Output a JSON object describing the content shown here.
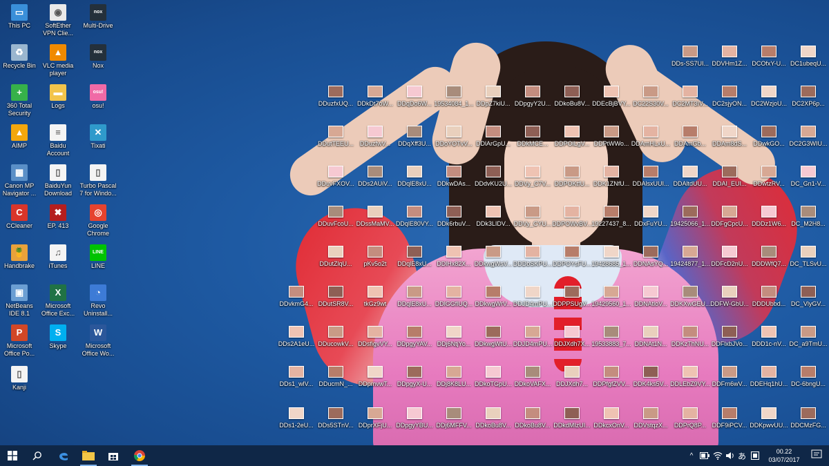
{
  "desktop": {
    "left_icons": [
      {
        "label": "This PC",
        "color": "#3a8fd9",
        "glyph": "▭",
        "icon": "computer-icon"
      },
      {
        "label": "SoftEther VPN Clie...",
        "color": "#e9e9e9",
        "glyph": "◉",
        "icon": "softether-icon"
      },
      {
        "label": "Multi-Drive",
        "color": "#24303b",
        "glyph": "nox",
        "icon": "nox-icon"
      },
      {
        "label": "Recycle Bin",
        "color": "#9ab6cf",
        "glyph": "♻",
        "icon": "recycle-bin-icon"
      },
      {
        "label": "VLC media player",
        "color": "#f08a00",
        "glyph": "▲",
        "icon": "vlc-icon"
      },
      {
        "label": "Nox",
        "color": "#24303b",
        "glyph": "nox",
        "icon": "nox-icon"
      },
      {
        "label": "360 Total Security",
        "color": "#36b14a",
        "glyph": "+",
        "icon": "shield-icon"
      },
      {
        "label": "Logs",
        "color": "#f2c44b",
        "glyph": "▬",
        "icon": "folder-icon"
      },
      {
        "label": "osu!",
        "color": "#f06aa6",
        "glyph": "osu!",
        "icon": "osu-icon"
      },
      {
        "label": "AIMP",
        "color": "#f3a70d",
        "glyph": "▲",
        "icon": "aimp-icon"
      },
      {
        "label": "Baidu Account",
        "color": "#f4f4f4",
        "glyph": "≡",
        "icon": "document-icon"
      },
      {
        "label": "Tixati",
        "color": "#2f9acb",
        "glyph": "✕",
        "icon": "tixati-icon"
      },
      {
        "label": "Canon MP Navigator ...",
        "color": "#5a8fc7",
        "glyph": "▦",
        "icon": "scanner-icon"
      },
      {
        "label": "BaiduYun Download",
        "color": "#f4f4f4",
        "glyph": "▯",
        "icon": "document-icon"
      },
      {
        "label": "Turbo Pascal 7 for Windo...",
        "color": "#f4f4f4",
        "glyph": "▯",
        "icon": "document-icon"
      },
      {
        "label": "CCleaner",
        "color": "#d9352a",
        "glyph": "C",
        "icon": "ccleaner-icon"
      },
      {
        "label": "EP. 413",
        "color": "#b41e1e",
        "glyph": "✖",
        "icon": "video-icon"
      },
      {
        "label": "Google Chrome",
        "color": "#e6432e",
        "glyph": "◎",
        "icon": "chrome-icon"
      },
      {
        "label": "Handbrake",
        "color": "#e9a23b",
        "glyph": "🍍",
        "icon": "handbrake-icon"
      },
      {
        "label": "iTunes",
        "color": "#f4f4f4",
        "glyph": "♫",
        "icon": "itunes-icon"
      },
      {
        "label": "LINE",
        "color": "#00c300",
        "glyph": "LINE",
        "icon": "line-icon"
      },
      {
        "label": "NetBeans IDE 8.1",
        "color": "#6b9ed3",
        "glyph": "▣",
        "icon": "netbeans-icon"
      },
      {
        "label": "Microsoft Office Exc...",
        "color": "#207245",
        "glyph": "X",
        "icon": "excel-icon"
      },
      {
        "label": "Revo Uninstall...",
        "color": "#3d7bd6",
        "glyph": "◔",
        "icon": "revo-icon"
      },
      {
        "label": "Microsoft Office Po...",
        "color": "#d24726",
        "glyph": "P",
        "icon": "powerpoint-icon"
      },
      {
        "label": "Skype",
        "color": "#00aff0",
        "glyph": "S",
        "icon": "skype-icon"
      },
      {
        "label": "Microsoft Office Wo...",
        "color": "#2b579a",
        "glyph": "W",
        "icon": "word-icon"
      },
      {
        "label": "Kanji",
        "color": "#f4f4f4",
        "glyph": "▯",
        "icon": "document-icon"
      }
    ],
    "file_rows": [
      {
        "names": [
          "DDs-SS7UI...",
          "DDVHm1Z...",
          "DCOfxY-U...",
          "DC1ubeqU..."
        ],
        "start": 16
      },
      {
        "names": [
          "DDuzfxUQ...",
          "DDkDt7oW...",
          "DDqDo6W...",
          "19534084_1...",
          "DDpZ7kiU...",
          "DDpgyY2U...",
          "DDkoBu8V...",
          "DDEcBjBVY...",
          "DC22S30V...",
          "DC2MT3IV...",
          "DC2sjyON...",
          "DC2WzjoU...",
          "DC2XP6p..."
        ],
        "start": 8
      },
      {
        "names": [
          "DDutTEEU...",
          "DDuzfwV...",
          "DDqXff3U...",
          "DDoYOTvV...",
          "DDlArGpU...",
          "DDkMCE...",
          "DDPOiLgV...",
          "DDPtWWo...",
          "DDAmHLxU...",
          "DDAmGb...",
          "DDAm8dS...",
          "DDwkGO...",
          "DC2G3WIU..."
        ],
        "start": 8
      },
      {
        "names": [
          "DDuvFXOV...",
          "DDs2AUiV...",
          "DDqlE8xU...",
          "DDkwDAs...",
          "DDdvKU2U...",
          "DDVy_C7V...",
          "DDPOKtfU...",
          "DDK1ZNfU...",
          "DDAlsxUUI...",
          "DDAltdUU...",
          "DDAI_EUI...",
          "DDwtzRV...",
          "DC_Gn1-V..."
        ],
        "start": 8
      },
      {
        "names": [
          "DDuvFcoU...",
          "DDssMaMV...",
          "DDqlE80VY...",
          "DDk6rbuV...",
          "DDk3LIDV...",
          "DDVy_CYU...",
          "DDPOWvBV...",
          "19227437_8...",
          "DDxFuYU...",
          "19425066_1...",
          "DDFgCpcU...",
          "DDDz1W6...",
          "DC_M2H8..."
        ],
        "start": 8
      },
      {
        "names": [
          "DDutZlqU...",
          "pKv5o2t",
          "DDqlE8xU...",
          "DDlHx82X...",
          "DDkwgWsV...",
          "DDDbSKPU...",
          "DDPOYsFU...",
          "19428685_1...",
          "DDNAsYQ...",
          "19424877_1...",
          "DDFcD2nU...",
          "DDDWfQ7...",
          "DC_TLSvU..."
        ],
        "start": 8
      },
      {
        "names": [
          "DDvkmG4...",
          "DDutSR8V...",
          "tkGz9wt",
          "DDqlE8xU...",
          "DDlGGflUQ...",
          "DDkwgWrV...",
          "DDJD4mPU...",
          "DDPPSUgV...",
          "19429560_1...",
          "DDNAtloV...",
          "DDKXwGEU...",
          "DDFW-GbU...",
          "DDDUbbd...",
          "DC_VlyGV..."
        ],
        "start": 7
      },
      {
        "names": [
          "DDs2A1eU...",
          "DDucowkV...",
          "DDsfigvVY...",
          "DDpgyYAV...",
          "DDj6NtjYo...",
          "DDkwgWtU...",
          "DDJD4mPU...",
          "DDJXdh7X...",
          "19533883_7...",
          "DDNAt1N...",
          "DDKzThNU...",
          "DDFlxbJVo...",
          "DDD1c-nV...",
          "DC_a9TmU..."
        ],
        "start": 7
      },
      {
        "names": [
          "DDs1_wlV...",
          "DDucmN_...",
          "DDpmvwT...",
          "DDpgyX-U...",
          "DDj8K8LU...",
          "DDkoTGpU...",
          "DDkoVAFX...",
          "DDJXdh7...",
          "DDPfgfZVV...",
          "DDK4ks5V...",
          "DDLEbZ9VY...",
          "DDFrn6wV...",
          "DDEHq1hU...",
          "DC-6bngU..."
        ],
        "start": 7
      },
      {
        "names": [
          "DDs1-2eU...",
          "DDs5STnV...",
          "DDprXFjU...",
          "DDpgyYBU...",
          "DDj6MFFV...",
          "DDkoBu8V...",
          "DDkoBu8V...",
          "DDkdMIzUI...",
          "DDkcxOnV...",
          "DDVstqzX...",
          "DDPrQ8P...",
          "DDF9iPCV...",
          "DDKpwvUU...",
          "DDCMzFG..."
        ],
        "start": 7
      }
    ],
    "thumb_colors": [
      "#c99a86",
      "#e4b3a2",
      "#b77d6a",
      "#f0d6c8",
      "#9c6b5c",
      "#d7a894",
      "#f6c9d2",
      "#a88c7b",
      "#e9d0bd",
      "#c48d7f",
      "#8e5f55",
      "#efc3b3"
    ]
  },
  "taskbar": {
    "start_icon": "windows-start-icon",
    "apps": [
      {
        "name": "search",
        "icon": "search-icon"
      },
      {
        "name": "edge",
        "icon": "edge-icon"
      },
      {
        "name": "file-explorer",
        "icon": "folder-icon"
      },
      {
        "name": "store",
        "icon": "store-icon"
      },
      {
        "name": "chrome",
        "icon": "chrome-icon"
      }
    ],
    "tray": {
      "ime_label": "あ",
      "time": "00.22",
      "date": "03/07/2017"
    }
  }
}
